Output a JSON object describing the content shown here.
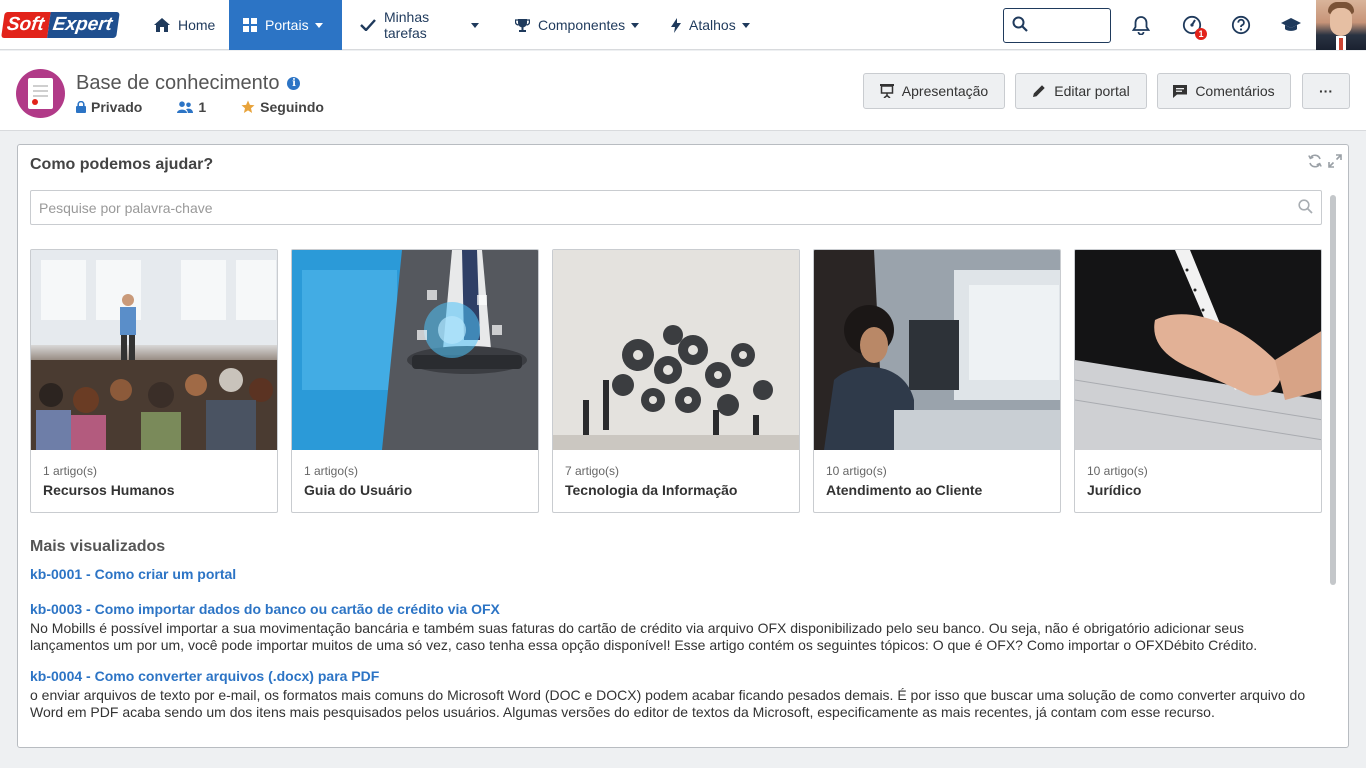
{
  "brand": {
    "part1": "Soft",
    "part2": "Expert"
  },
  "nav": {
    "items": [
      {
        "label": "Home"
      },
      {
        "label": "Portais"
      },
      {
        "label": "Minhas tarefas"
      },
      {
        "label": "Componentes"
      },
      {
        "label": "Atalhos"
      }
    ],
    "notification_badge": "1"
  },
  "portal": {
    "title": "Base de conhecimento",
    "privacy": "Privado",
    "members": "1",
    "following": "Seguindo",
    "buttons": {
      "presentation": "Apresentação",
      "edit": "Editar portal",
      "comments": "Comentários",
      "more": "···"
    }
  },
  "widget": {
    "title": "Como podemos ajudar?",
    "search_placeholder": "Pesquise por palavra-chave",
    "categories": [
      {
        "count": "1 artigo(s)",
        "name": "Recursos Humanos"
      },
      {
        "count": "1 artigo(s)",
        "name": "Guia do Usuário"
      },
      {
        "count": "7 artigo(s)",
        "name": "Tecnologia da Informação"
      },
      {
        "count": "10 artigo(s)",
        "name": "Atendimento ao Cliente"
      },
      {
        "count": "10 artigo(s)",
        "name": "Jurídico"
      }
    ],
    "most_viewed_title": "Mais visualizados",
    "articles": [
      {
        "title": "kb-0001 - Como criar um portal",
        "description": ""
      },
      {
        "title": "kb-0003 - Como importar dados do banco ou cartão de crédito via OFX",
        "description": "No Mobills é possível importar a sua movimentação bancária e também suas faturas do cartão de crédito via arquivo OFX disponibilizado pelo seu banco. Ou seja, não é obrigatório adicionar seus lançamentos um por um, você pode importar muitos de uma só vez, caso tenha essa opção disponível! Esse artigo contém os seguintes tópicos: O que é OFX? Como importar o OFXDébito Crédito."
      },
      {
        "title": "kb-0004 - Como converter arquivos (.docx) para PDF",
        "description": "o enviar arquivos de texto por e-mail, os formatos mais comuns do Microsoft Word (DOC e DOCX) podem acabar ficando pesados demais. É por isso que buscar uma solução de como converter arquivo do Word em PDF acaba sendo um dos itens mais pesquisados pelos usuários. Algumas versões do editor de textos da Microsoft, especificamente as mais recentes, já contam com esse recurso."
      }
    ]
  },
  "colors": {
    "accent": "#2c74c5",
    "nav_text": "#1f3a5c",
    "portal_icon": "#b13a88",
    "brand_red": "#e2231a",
    "brand_blue": "#1f4f8f",
    "star": "#e8a33b"
  },
  "icons": {
    "home": "home-icon",
    "portais": "grid-icon",
    "tarefas": "check-icon",
    "componentes": "trophy-icon",
    "atalhos": "bolt-icon"
  }
}
